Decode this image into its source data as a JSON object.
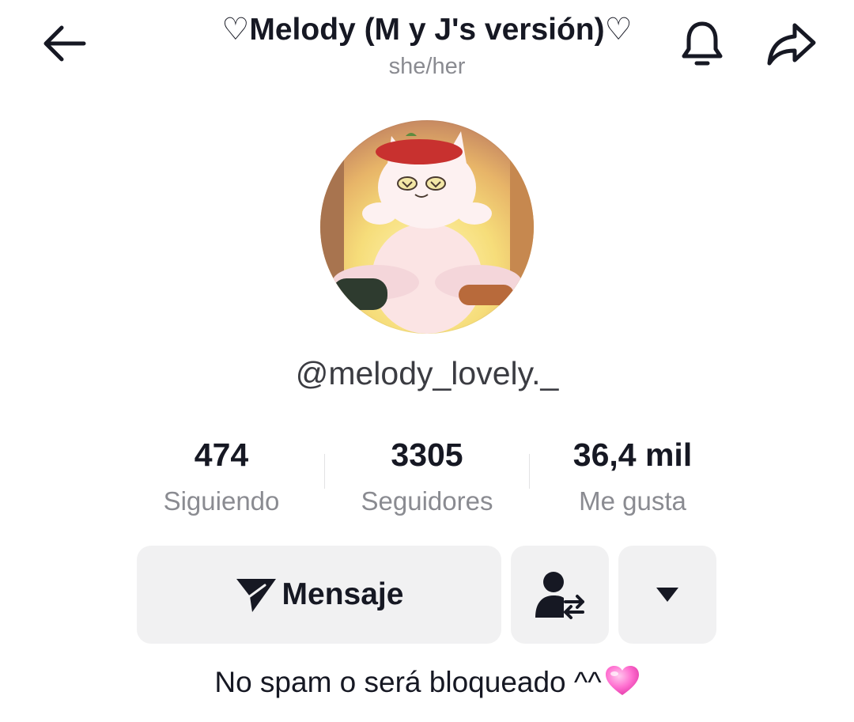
{
  "header": {
    "title": "♡Melody (M y J's versión)♡",
    "pronouns": "she/her",
    "icons": {
      "back": "arrow-left-icon",
      "notifications": "bell-icon",
      "share": "share-arrow-icon"
    }
  },
  "profile": {
    "avatar": "profile-avatar",
    "username": "@melody_lovely._"
  },
  "stats": [
    {
      "value": "474",
      "label": "Siguiendo"
    },
    {
      "value": "3305",
      "label": "Seguidores"
    },
    {
      "value": "36,4 mil",
      "label": "Me gusta"
    }
  ],
  "actions": {
    "message_label": "Mensaje",
    "message_icon": "paper-plane-icon",
    "follow_icon": "user-swap-icon",
    "more_icon": "caret-down-icon"
  },
  "bio": {
    "text": "No spam o será bloqueado ^^",
    "emoji": "pink-heart-icon"
  },
  "colors": {
    "text_primary": "#161823",
    "text_secondary": "#8a8b91",
    "button_bg": "#f1f1f2",
    "heart": "#ff5fc8"
  }
}
